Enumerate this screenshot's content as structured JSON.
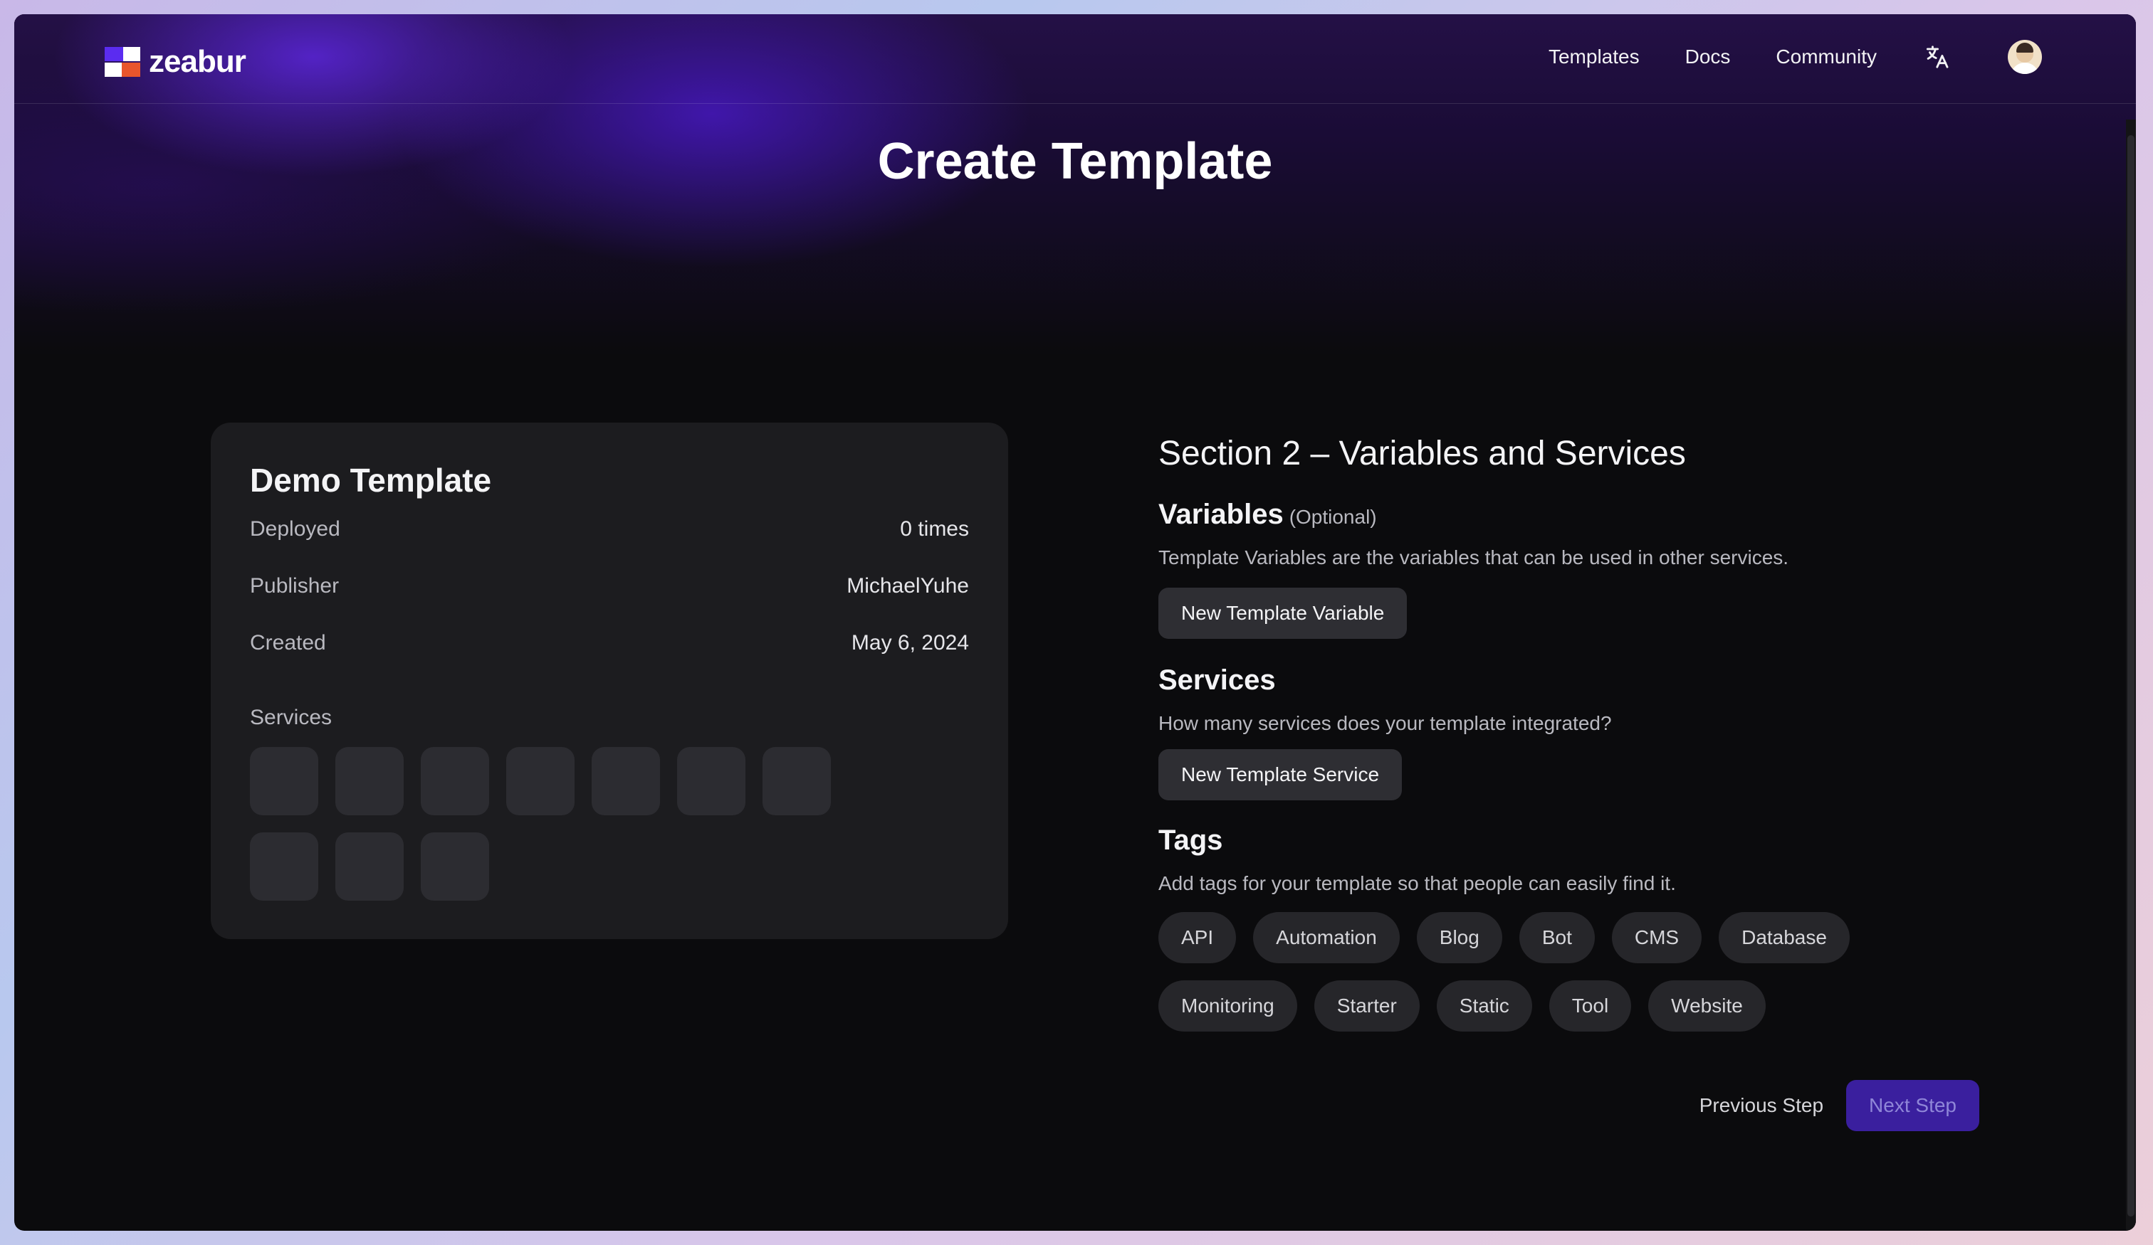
{
  "brand": {
    "name": "zeabur",
    "colors": {
      "purple": "#5b2cf0",
      "orange": "#e8552c",
      "primary_button": "#3a1f9e"
    }
  },
  "nav": {
    "links": [
      "Templates",
      "Docs",
      "Community"
    ],
    "icons": {
      "language": "translate-icon",
      "avatar": "user-avatar"
    }
  },
  "page": {
    "title": "Create Template"
  },
  "template_card": {
    "title": "Demo Template",
    "rows": [
      {
        "label": "Deployed",
        "value": "0 times"
      },
      {
        "label": "Publisher",
        "value": "MichaelYuhe"
      },
      {
        "label": "Created",
        "value": "May 6, 2024"
      }
    ],
    "services_label": "Services",
    "service_slots": 10
  },
  "section": {
    "title": "Section 2 – Variables and Services",
    "variables": {
      "heading": "Variables",
      "optional": "(Optional)",
      "description": "Template Variables are the variables that can be used in other services.",
      "button": "New Template Variable"
    },
    "services": {
      "heading": "Services",
      "description": "How many services does your template integrated?",
      "button": "New Template Service"
    },
    "tags": {
      "heading": "Tags",
      "description": "Add tags for your template so that people can easily find it.",
      "items": [
        "API",
        "Automation",
        "Blog",
        "Bot",
        "CMS",
        "Database",
        "Monitoring",
        "Starter",
        "Static",
        "Tool",
        "Website"
      ]
    },
    "actions": {
      "previous": "Previous Step",
      "next": "Next Step"
    }
  }
}
